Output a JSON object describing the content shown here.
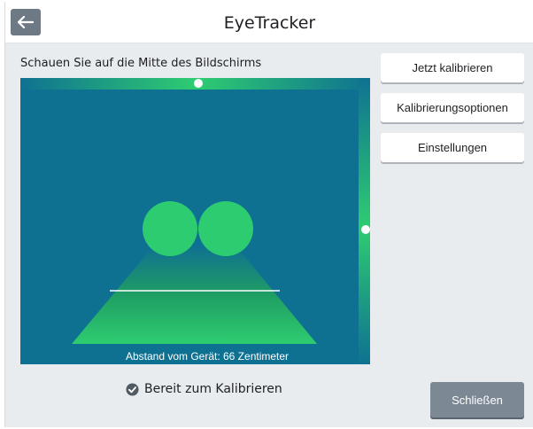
{
  "window": {
    "title": "EyeTracker",
    "back_icon": "arrow-left-icon"
  },
  "instruction": "Schauen Sie auf die Mitte des Bildschirms",
  "tracker": {
    "distance_label": "Abstand vom Gerät: 66 Zentimeter",
    "colors": {
      "background": "#0f7191",
      "eye": "#2ecc71",
      "cone": "#27ae60"
    }
  },
  "side_buttons": [
    {
      "label": "Jetzt kalibrieren"
    },
    {
      "label": "Kalibrierungsoptionen"
    },
    {
      "label": "Einstellungen"
    }
  ],
  "status": {
    "icon": "check-circle-icon",
    "label": "Bereit zum Kalibrieren"
  },
  "close_button": {
    "label": "Schließen"
  }
}
